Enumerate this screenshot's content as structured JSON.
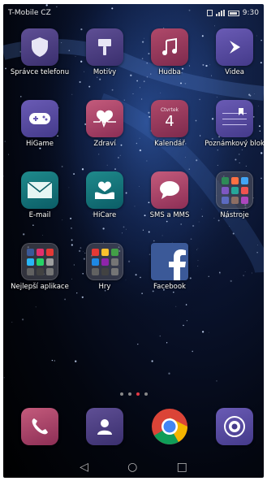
{
  "status": {
    "carrier": "T-Mobile CZ",
    "time": "9:30"
  },
  "apps": [
    {
      "id": "spravce",
      "label": "Správce telefonu",
      "icon": "shield-icon",
      "color": "#5f4f95"
    },
    {
      "id": "motivy",
      "label": "Motivy",
      "icon": "paintbrush-icon",
      "color": "#5f4f95"
    },
    {
      "id": "hudba",
      "label": "Hudba",
      "icon": "music-note-icon",
      "color": "#b0496a"
    },
    {
      "id": "videa",
      "label": "Videa",
      "icon": "play-icon",
      "color": "#6a5bb5"
    },
    {
      "id": "higame",
      "label": "HiGame",
      "icon": "gamepad-icon",
      "color": "#6a5bb5"
    },
    {
      "id": "zdravi",
      "label": "Zdraví",
      "icon": "heart-pulse-icon",
      "color": "#c45b7c"
    },
    {
      "id": "kalendar",
      "label": "Kalendář",
      "icon": "calendar-icon",
      "color": "#b0496a",
      "day_name": "Čtvrtek",
      "day_number": "4"
    },
    {
      "id": "poznamkovy",
      "label": "Poznámkový blok",
      "icon": "notepad-icon",
      "color": "#6a5bb5"
    },
    {
      "id": "email",
      "label": "E-mail",
      "icon": "envelope-icon",
      "color": "#1f8a8c"
    },
    {
      "id": "hicare",
      "label": "HiCare",
      "icon": "hand-heart-icon",
      "color": "#1f8a8c"
    },
    {
      "id": "sms",
      "label": "SMS a MMS",
      "icon": "chat-bubble-icon",
      "color": "#c45b7c"
    },
    {
      "id": "nastroje",
      "label": "Nástroje",
      "icon": "folder-icon",
      "color": "#5a5a64"
    },
    {
      "id": "nejlepsi",
      "label": "Nejlepší aplikace",
      "icon": "folder-icon",
      "color": "#5a5a64"
    },
    {
      "id": "hry",
      "label": "Hry",
      "icon": "folder-icon",
      "color": "#5a5a64"
    },
    {
      "id": "facebook",
      "label": "Facebook",
      "icon": "facebook-icon",
      "color": "#3b5998"
    }
  ],
  "page_indicator": {
    "count": 3,
    "active": 2
  },
  "dock": [
    {
      "id": "phone",
      "icon": "phone-icon",
      "color": "#b0496a"
    },
    {
      "id": "contacts",
      "icon": "contacts-icon",
      "color": "#5f4f95"
    },
    {
      "id": "chrome",
      "icon": "chrome-icon",
      "color": "#4285f4"
    },
    {
      "id": "camera",
      "icon": "camera-icon",
      "color": "#5f4f95"
    }
  ],
  "nav": {
    "back": "◁",
    "home": "○",
    "recents": "□"
  }
}
